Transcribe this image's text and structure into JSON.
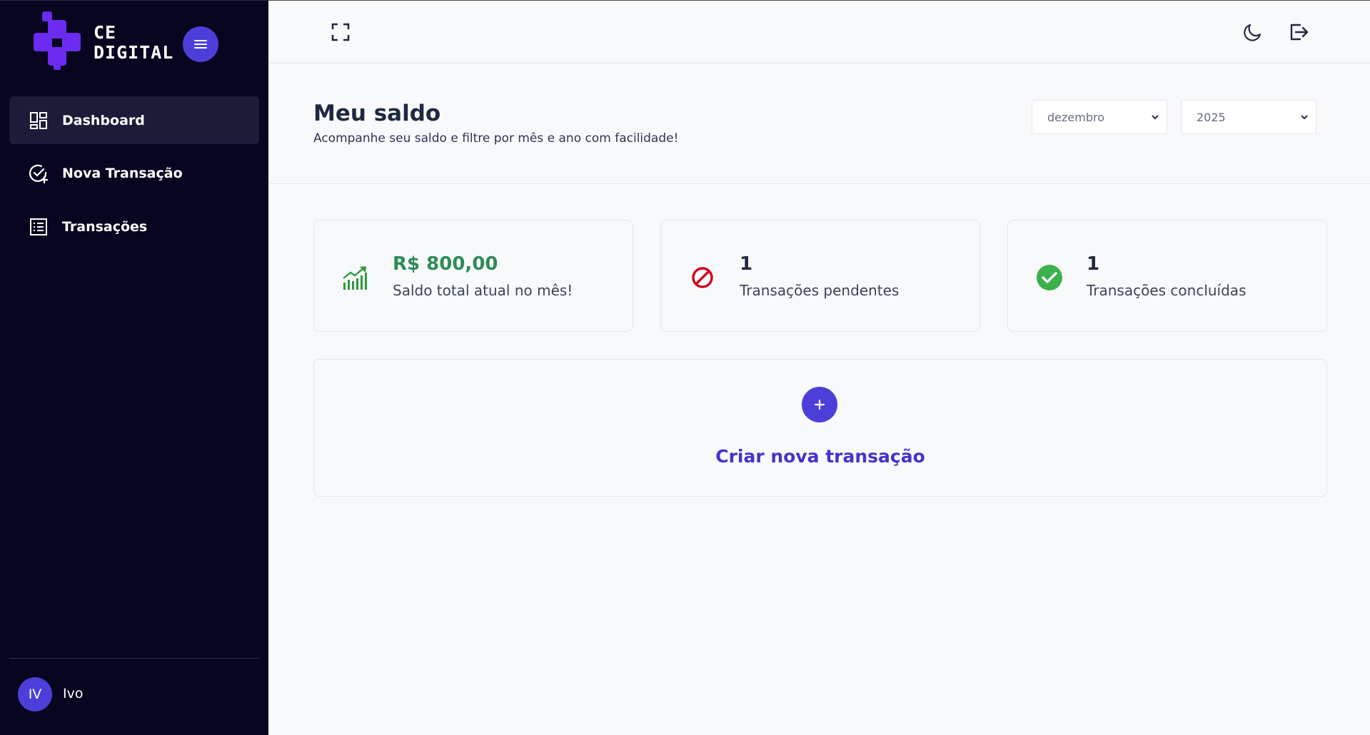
{
  "brand": {
    "name_line1": "CE",
    "name_line2": "DIGITAL",
    "logo_color": "#6b2bf0"
  },
  "sidebar": {
    "items": [
      {
        "label": "Dashboard",
        "icon": "dashboard-icon",
        "active": true
      },
      {
        "label": "Nova Transação",
        "icon": "check-plus-icon",
        "active": false
      },
      {
        "label": "Transações",
        "icon": "list-icon",
        "active": false
      }
    ],
    "user": {
      "initials": "IV",
      "name": "Ivo"
    }
  },
  "topbar": {
    "icons": [
      "fullscreen-icon",
      "moon-icon",
      "logout-icon"
    ]
  },
  "header": {
    "title": "Meu saldo",
    "subtitle": "Acompanhe seu saldo e filtre por mês e ano com facilidade!",
    "month_select": "dezembro",
    "year_select": "2025"
  },
  "cards": [
    {
      "value": "R$ 800,00",
      "label": "Saldo total atual no mês!",
      "icon": "chart-up-icon",
      "value_color": "#2e8b57"
    },
    {
      "value": "1",
      "label": "Transações pendentes",
      "icon": "blocked-icon",
      "value_color": "#1e2940"
    },
    {
      "value": "1",
      "label": "Transações concluídas",
      "icon": "check-circle-icon",
      "value_color": "#1e2940"
    }
  ],
  "create": {
    "label": "Criar nova transação"
  },
  "colors": {
    "accent": "#4c3fd9",
    "sidebar_bg": "#07051f",
    "success": "#3cb04a",
    "danger": "#d0021b"
  }
}
